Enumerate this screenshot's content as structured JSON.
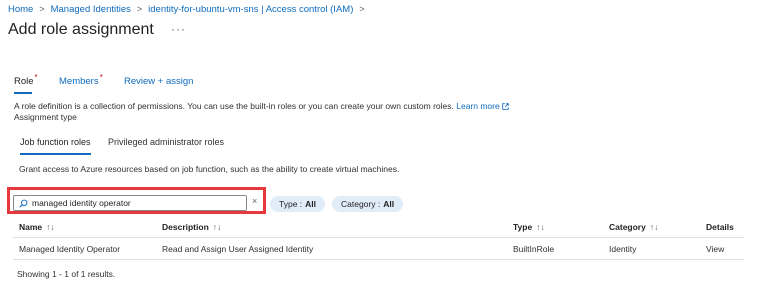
{
  "breadcrumb": {
    "items": [
      "Home",
      "Managed Identities",
      "identity-for-ubuntu-vm-sns | Access control (IAM)"
    ]
  },
  "header": {
    "title": "Add role assignment",
    "more": "···"
  },
  "tabs": [
    {
      "label": "Role",
      "required": "*"
    },
    {
      "label": "Members",
      "required": "*"
    },
    {
      "label": "Review + assign"
    }
  ],
  "role_description": {
    "text": "A role definition is a collection of permissions. You can use the built-in roles or you can create your own custom roles.",
    "learn_more": "Learn more",
    "assignment_type": "Assignment type"
  },
  "sub_tabs": [
    "Job function roles",
    "Privileged administrator roles"
  ],
  "grant_text": "Grant access to Azure resources based on job function, such as the ability to create virtual machines.",
  "search": {
    "value": "managed identity operator",
    "clear": "×"
  },
  "filters": [
    {
      "label": "Type :",
      "value": "All"
    },
    {
      "label": "Category :",
      "value": "All"
    }
  ],
  "table": {
    "columns": [
      "Name",
      "Description",
      "Type",
      "Category",
      "Details"
    ],
    "sort_glyph": "↑↓",
    "rows": [
      {
        "name": "Managed Identity Operator",
        "description": "Read and Assign User Assigned Identity",
        "type": "BuiltInRole",
        "category": "Identity",
        "details": "View"
      }
    ]
  },
  "footer": "Showing 1 - 1 of 1 results.",
  "colors": {
    "accent": "#0f6cbd",
    "highlight": "#e8383f",
    "required": "#c50f1f",
    "pill": "#e1ecf9"
  }
}
